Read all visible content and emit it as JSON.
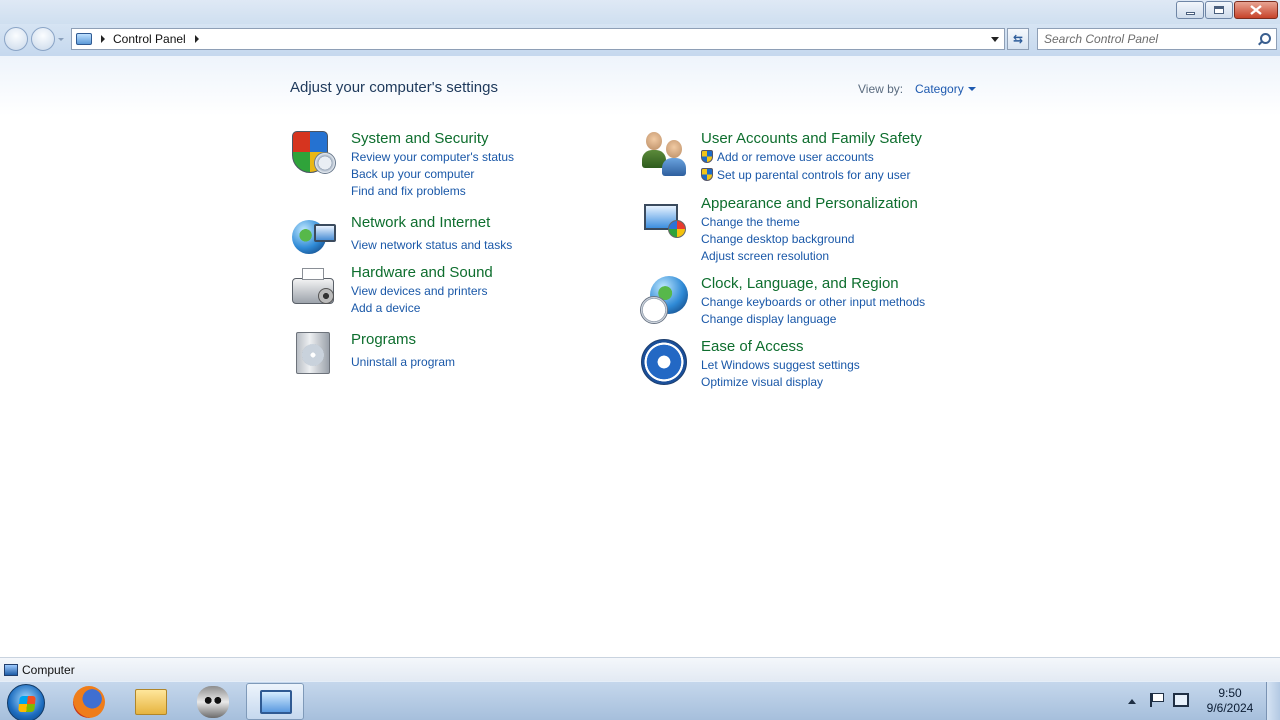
{
  "window": {
    "controls": {
      "minimize": "minimize",
      "maximize": "restore",
      "close": "close"
    }
  },
  "navbar": {
    "breadcrumb": [
      "Control Panel"
    ],
    "search_placeholder": "Search Control Panel"
  },
  "main": {
    "title": "Adjust your computer's settings",
    "view_by_label": "View by:",
    "view_by_value": "Category",
    "categories_left": [
      {
        "title": "System and Security",
        "icon": "shield-icon",
        "links": [
          "Review your computer's status",
          "Back up your computer",
          "Find and fix problems"
        ]
      },
      {
        "title": "Network and Internet",
        "icon": "network-globe-icon",
        "links": [
          "View network status and tasks"
        ]
      },
      {
        "title": "Hardware and Sound",
        "icon": "printer-icon",
        "links": [
          "View devices and printers",
          "Add a device"
        ]
      },
      {
        "title": "Programs",
        "icon": "programs-icon",
        "links": [
          "Uninstall a program"
        ]
      }
    ],
    "categories_right": [
      {
        "title": "User Accounts and Family Safety",
        "icon": "users-icon",
        "links": [
          "Add or remove user accounts",
          "Set up parental controls for any user"
        ]
      },
      {
        "title": "Appearance and Personalization",
        "icon": "appearance-icon",
        "links": [
          "Change the theme",
          "Change desktop background",
          "Adjust screen resolution"
        ]
      },
      {
        "title": "Clock, Language, and Region",
        "icon": "clock-globe-icon",
        "links": [
          "Change keyboards or other input methods",
          "Change display language"
        ]
      },
      {
        "title": "Ease of Access",
        "icon": "ease-of-access-icon",
        "links": [
          "Let Windows suggest settings",
          "Optimize visual display"
        ]
      }
    ]
  },
  "statusbar": {
    "text": "Computer"
  },
  "taskbar": {
    "clock_time": "9:50",
    "clock_date": "9/6/2024"
  }
}
